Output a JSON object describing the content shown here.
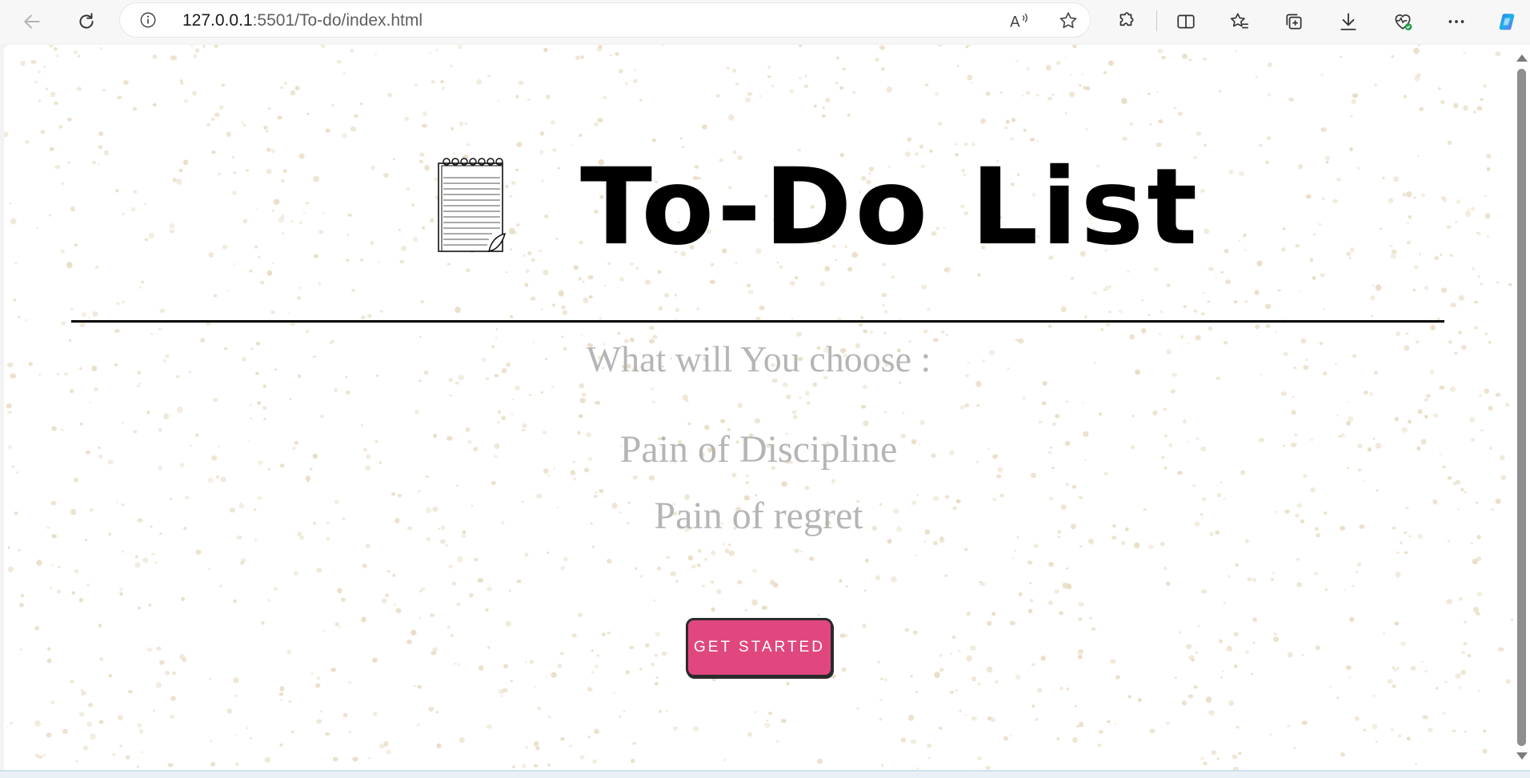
{
  "browser": {
    "url_host": "127.0.0.1",
    "url_rest": ":5501/To-do/index.html",
    "icons": {
      "back": "back-arrow-icon",
      "refresh": "refresh-icon",
      "site_info": "info-icon",
      "read_aloud": "read-aloud-icon",
      "favorite": "star-icon",
      "extensions": "puzzle-icon",
      "split_screen": "split-screen-icon",
      "favorites": "favorites-icon",
      "collections": "collections-icon",
      "downloads": "download-icon",
      "browser_essentials": "heart-pulse-icon",
      "more": "more-icon",
      "copilot": "copilot-icon"
    }
  },
  "page": {
    "title": "To-Do List",
    "question": "What will You choose :",
    "choices": [
      "Pain of Discipline",
      "Pain of regret"
    ],
    "cta_label": "GET STARTED",
    "colors": {
      "background": "#ffffff",
      "speckle": "#e8dcc4",
      "muted_text": "#b5b5b5",
      "button": "#e0477f",
      "button_text": "#ffffff"
    }
  }
}
